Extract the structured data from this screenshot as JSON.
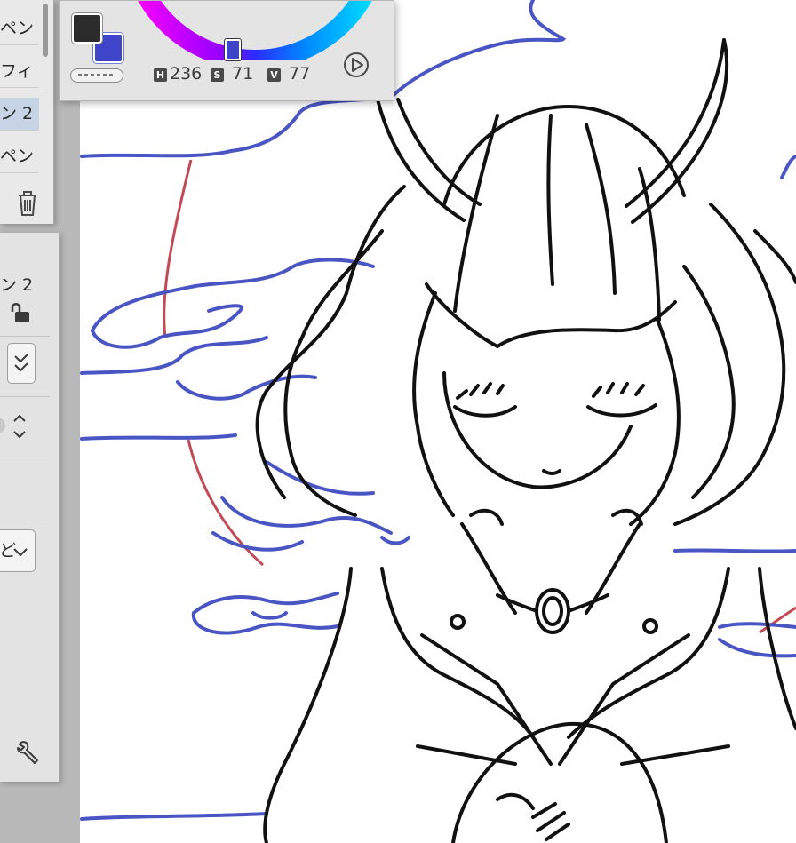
{
  "layer_list": {
    "items": [
      {
        "label": "ペン",
        "selected": false
      },
      {
        "label": "フィ",
        "selected": false
      },
      {
        "label": "ン 2",
        "selected": true
      },
      {
        "label": "ペン",
        "selected": false
      }
    ],
    "delete_icon": "trash-icon"
  },
  "layer_properties": {
    "layer_name": "ン 2",
    "blend_mode_visible": "ど",
    "icons": [
      "lock-icon",
      "double-check-icon",
      "stepper-icon",
      "chevron-down-icon",
      "wrench-icon"
    ]
  },
  "color_picker": {
    "primary_color": "#2c2c2c",
    "secondary_color": "#3f45c8",
    "h_label": "H",
    "h_value": "236",
    "s_label": "S",
    "s_value": "71",
    "v_label": "V",
    "v_value": "77",
    "play_icon": "play-circle-icon"
  },
  "canvas": {
    "line_color": "#111111",
    "guide_blue": "#4a55c4",
    "guide_red": "#c24a55"
  }
}
